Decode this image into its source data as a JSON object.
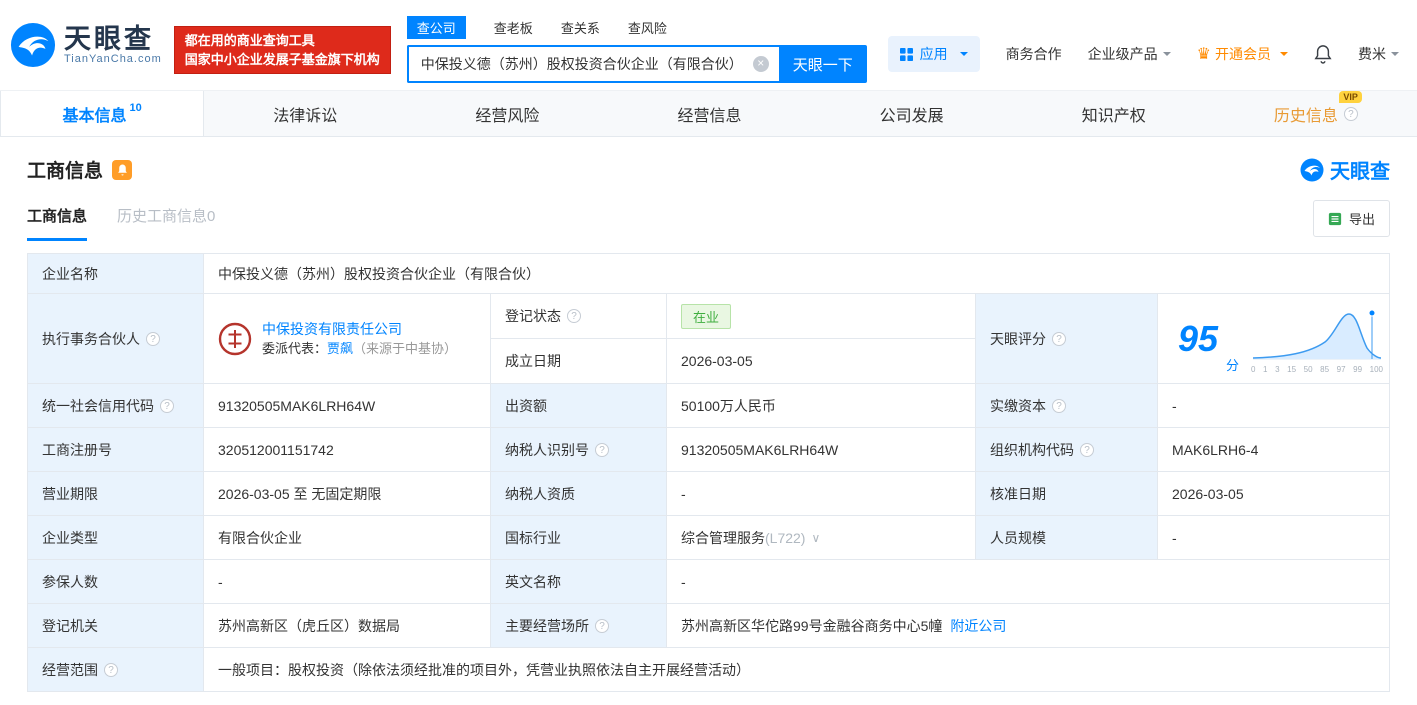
{
  "colors": {
    "accent": "#0084ff",
    "banner_red": "#de2a1b",
    "vip_orange": "#ff8a00",
    "status_green": "#3fae3f",
    "label_bg": "#e9f3fd"
  },
  "icons": {
    "question_mark": "?",
    "crown": "♛",
    "clear": "×",
    "dropdown": "∨"
  },
  "header": {
    "logo": {
      "title": "天眼查",
      "subtitle": "TianYanCha.com"
    },
    "banner": {
      "line1": "都在用的商业查询工具",
      "line2": "国家中小企业发展子基金旗下机构"
    },
    "search_tabs": [
      {
        "label": "查公司"
      },
      {
        "label": "查老板"
      },
      {
        "label": "查关系"
      },
      {
        "label": "查风险"
      }
    ],
    "search": {
      "value": "中保投义德（苏州）股权投资合伙企业（有限合伙）",
      "button": "天眼一下"
    },
    "menu": {
      "apps": "应用",
      "coop": "商务合作",
      "product": "企业级产品",
      "vip": "开通会员",
      "user": "费米"
    }
  },
  "nav_tabs": [
    {
      "label": "基本信息",
      "count": "10"
    },
    {
      "label": "法律诉讼"
    },
    {
      "label": "经营风险"
    },
    {
      "label": "经营信息"
    },
    {
      "label": "公司发展"
    },
    {
      "label": "知识产权"
    },
    {
      "label": "历史信息",
      "badge": "VIP"
    }
  ],
  "section": {
    "title": "工商信息",
    "brand": "天眼查",
    "sub_tabs": [
      {
        "label": "工商信息"
      },
      {
        "label": "历史工商信息",
        "count": "0"
      }
    ],
    "export_label": "导出"
  },
  "table": {
    "company_name_label": "企业名称",
    "company_name": "中保投义德（苏州）股权投资合伙企业（有限合伙）",
    "partner_label": "执行事务合伙人",
    "partner_name": "中保投资有限责任公司",
    "partner_rep_label": "委派代表：",
    "partner_rep_name": "贾飙",
    "partner_rep_source": "（来源于中基协）",
    "reg_status_label": "登记状态",
    "reg_status": "在业",
    "establish_date_label": "成立日期",
    "establish_date": "2026-03-05",
    "score_label": "天眼评分",
    "score_value": "95",
    "score_unit": "分",
    "credit_code_label": "统一社会信用代码",
    "credit_code": "91320505MAK6LRH64W",
    "capital_label": "出资额",
    "capital": "50100万人民币",
    "paid_capital_label": "实缴资本",
    "paid_capital": "-",
    "reg_number_label": "工商注册号",
    "reg_number": "320512001151742",
    "taxpayer_id_label": "纳税人识别号",
    "taxpayer_id": "91320505MAK6LRH64W",
    "org_code_label": "组织机构代码",
    "org_code": "MAK6LRH6-4",
    "business_term_label": "营业期限",
    "business_term": "2026-03-05 至 无固定期限",
    "taxpayer_quality_label": "纳税人资质",
    "taxpayer_quality": "-",
    "approval_date_label": "核准日期",
    "approval_date": "2026-03-05",
    "company_type_label": "企业类型",
    "company_type": "有限合伙企业",
    "industry_label": "国标行业",
    "industry": "综合管理服务",
    "industry_code": "(L722)",
    "staff_size_label": "人员规模",
    "staff_size": "-",
    "insured_label": "参保人数",
    "insured": "-",
    "english_name_label": "英文名称",
    "english_name": "-",
    "reg_authority_label": "登记机关",
    "reg_authority": "苏州高新区（虎丘区）数据局",
    "business_place_label": "主要经营场所",
    "business_place": "苏州高新区华佗路99号金融谷商务中心5幢",
    "nearby_link": "附近公司",
    "business_scope_label": "经营范围",
    "business_scope": "一般项目：股权投资（除依法须经批准的项目外，凭营业执照依法自主开展经营活动）"
  },
  "score_chart": {
    "ticks": [
      "0",
      "1",
      "3",
      "15",
      "50",
      "85",
      "97",
      "99",
      "100"
    ]
  }
}
